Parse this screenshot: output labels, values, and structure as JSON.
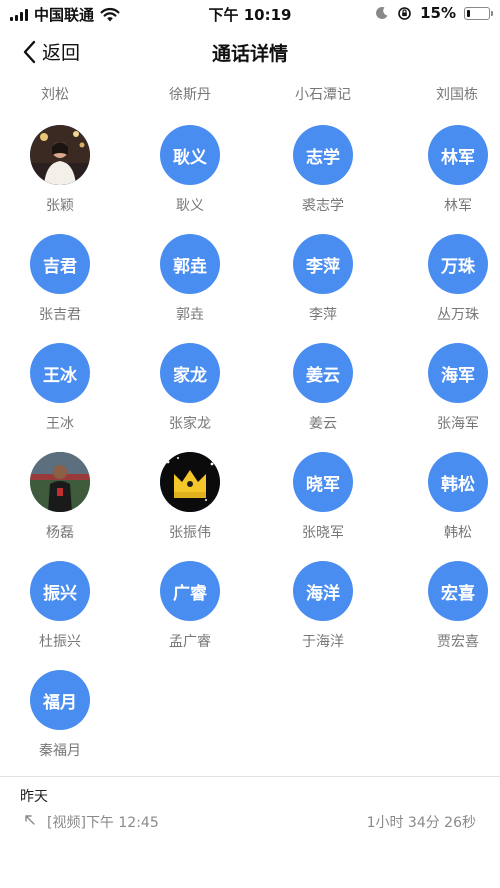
{
  "status_bar": {
    "carrier": "中国联通",
    "time": "下午 10:19",
    "battery": "15%",
    "battery_level": 0.15,
    "icons": [
      "signal-icon",
      "wifi-icon",
      "moon-icon",
      "orientation-lock-icon",
      "battery-icon"
    ]
  },
  "nav": {
    "back_label": "返回",
    "title": "通话详情"
  },
  "top_names": [
    "刘松",
    "徐斯丹",
    "小石潭记",
    "刘国栋"
  ],
  "contacts": [
    {
      "avatar_text": "",
      "avatar_type": "photo-person",
      "name": "张颖"
    },
    {
      "avatar_text": "耿义",
      "avatar_type": "initials",
      "name": "耿义"
    },
    {
      "avatar_text": "志学",
      "avatar_type": "initials",
      "name": "裘志学"
    },
    {
      "avatar_text": "林军",
      "avatar_type": "initials",
      "name": "林军"
    },
    {
      "avatar_text": "吉君",
      "avatar_type": "initials",
      "name": "张吉君"
    },
    {
      "avatar_text": "郭垚",
      "avatar_type": "initials",
      "name": "郭垚"
    },
    {
      "avatar_text": "李萍",
      "avatar_type": "initials",
      "name": "李萍"
    },
    {
      "avatar_text": "万珠",
      "avatar_type": "initials",
      "name": "丛万珠"
    },
    {
      "avatar_text": "王冰",
      "avatar_type": "initials",
      "name": "王冰"
    },
    {
      "avatar_text": "家龙",
      "avatar_type": "initials",
      "name": "张家龙"
    },
    {
      "avatar_text": "姜云",
      "avatar_type": "initials",
      "name": "姜云"
    },
    {
      "avatar_text": "海军",
      "avatar_type": "initials",
      "name": "张海军"
    },
    {
      "avatar_text": "",
      "avatar_type": "photo-player",
      "name": "杨磊"
    },
    {
      "avatar_text": "",
      "avatar_type": "photo-crown",
      "name": "张振伟"
    },
    {
      "avatar_text": "晓军",
      "avatar_type": "initials",
      "name": "张晓军"
    },
    {
      "avatar_text": "韩松",
      "avatar_type": "initials",
      "name": "韩松"
    },
    {
      "avatar_text": "振兴",
      "avatar_type": "initials",
      "name": "杜振兴"
    },
    {
      "avatar_text": "广睿",
      "avatar_type": "initials",
      "name": "孟广睿"
    },
    {
      "avatar_text": "海洋",
      "avatar_type": "initials",
      "name": "于海洋"
    },
    {
      "avatar_text": "宏喜",
      "avatar_type": "initials",
      "name": "贾宏喜"
    },
    {
      "avatar_text": "福月",
      "avatar_type": "initials",
      "name": "秦福月"
    }
  ],
  "history": {
    "date": "昨天",
    "calls": [
      {
        "type": "[视频]",
        "time": "下午 12:45",
        "duration": "1小时 34分 26秒",
        "direction_icon": "outgoing-call-arrow-icon"
      }
    ]
  },
  "colors": {
    "avatar_blue": "#4a8df0",
    "label_gray": "#777777"
  }
}
